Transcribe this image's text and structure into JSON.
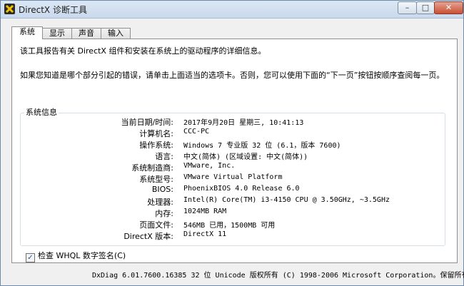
{
  "window": {
    "title": "DirectX 诊断工具",
    "minimize_symbol": "–",
    "maximize_symbol": "□",
    "close_symbol": "✕"
  },
  "tabs": [
    {
      "label": "系统",
      "active": true
    },
    {
      "label": "显示",
      "active": false
    },
    {
      "label": "声音",
      "active": false
    },
    {
      "label": "输入",
      "active": false
    }
  ],
  "intro": {
    "line1": "该工具报告有关 DirectX 组件和安装在系统上的驱动程序的详细信息。",
    "line2": "如果您知道是哪个部分引起的错误，请单击上面适当的选项卡。否则，您可以使用下面的“下一页”按钮按顺序查阅每一页。"
  },
  "system_info": {
    "title": "系统信息",
    "rows": [
      {
        "label": "当前日期/时间:",
        "value": "2017年9月20日 星期三, 10:41:13"
      },
      {
        "label": "计算机名:",
        "value": "CCC-PC"
      },
      {
        "label": "操作系统:",
        "value": "Windows 7 专业版 32 位 (6.1，版本 7600)"
      },
      {
        "label": "语言:",
        "value": "中文(简体) (区域设置: 中文(简体))"
      },
      {
        "label": "系统制造商:",
        "value": "VMware, Inc."
      },
      {
        "label": "系统型号:",
        "value": "VMware Virtual Platform"
      },
      {
        "label": "BIOS:",
        "value": "PhoenixBIOS 4.0 Release 6.0"
      },
      {
        "label": "处理器:",
        "value": "Intel(R) Core(TM) i3-4150 CPU @ 3.50GHz, ~3.5GHz"
      },
      {
        "label": "内存:",
        "value": "1024MB RAM"
      },
      {
        "label": "页面文件:",
        "value": "546MB 已用，1500MB 可用"
      },
      {
        "label": "DirectX 版本:",
        "value": "DirectX 11"
      }
    ]
  },
  "whql_checkbox": {
    "label": "检查 WHQL 数字签名(C)",
    "checked": true,
    "check_symbol": "✓"
  },
  "footer": {
    "text": "DxDiag 6.01.7600.16385 32 位 Unicode 版权所有 (C) 1998-2006 Microsoft Corporation。保留所有权"
  },
  "icons": {
    "app": "directx-x-icon"
  },
  "colors": {
    "titlebar": "#c9d9ec",
    "close_button": "#c94f34",
    "panel_border": "#8e8f8f",
    "group_border": "#d5dfe5"
  }
}
